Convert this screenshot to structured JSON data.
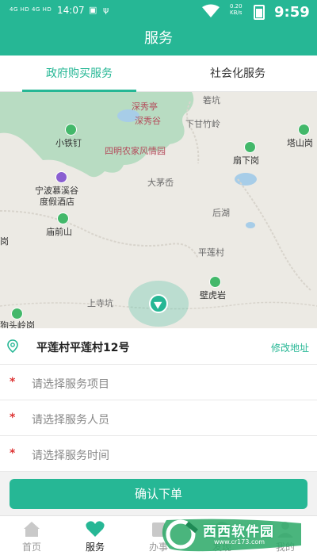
{
  "status_bar": {
    "signal": "4G HD 4G HD",
    "clock": "14:07",
    "speed": "0.20\nKB/s",
    "big_time": "9:59"
  },
  "header": {
    "title": "服务"
  },
  "tabs": [
    {
      "label": "政府购买服务",
      "active": true
    },
    {
      "label": "社会化服务",
      "active": false
    }
  ],
  "map": {
    "pois": [
      {
        "id": "shenxiuting",
        "label": "深秀亭",
        "style": "pink"
      },
      {
        "id": "shenxiugu",
        "label": "深秀谷",
        "style": "pink"
      },
      {
        "id": "ruokeng",
        "label": "箬坑",
        "style": "gray"
      },
      {
        "id": "xiaganzhuling",
        "label": "下甘竹岭",
        "style": "gray"
      },
      {
        "id": "tashanggang",
        "label": "塔山岗",
        "style": "normal"
      },
      {
        "id": "xiaotieding",
        "label": "小铁钉",
        "style": "normal"
      },
      {
        "id": "simingnongjia",
        "label": "四明农家风情园",
        "style": "pink"
      },
      {
        "id": "shanxiagang",
        "label": "扇下岗",
        "style": "normal"
      },
      {
        "id": "ningbo_hotel_1",
        "label": "宁波慕溪谷",
        "style": "normal"
      },
      {
        "id": "ningbo_hotel_2",
        "label": "度假酒店",
        "style": "normal"
      },
      {
        "id": "damaoan",
        "label": "大茅岙",
        "style": "gray"
      },
      {
        "id": "houhu",
        "label": "后湖",
        "style": "gray"
      },
      {
        "id": "miaoqianshan",
        "label": "庙前山",
        "style": "normal"
      },
      {
        "id": "gang_left",
        "label": "岗",
        "style": "normal"
      },
      {
        "id": "pinglian",
        "label": "平莲村",
        "style": "gray"
      },
      {
        "id": "bihuyan",
        "label": "壁虎岩",
        "style": "normal"
      },
      {
        "id": "shangsikeng",
        "label": "上寺坑",
        "style": "gray"
      },
      {
        "id": "goutouling",
        "label": "狗头岭岗",
        "style": "normal"
      }
    ]
  },
  "address": {
    "text": "平莲村平莲村12号",
    "edit_label": "修改地址"
  },
  "form": {
    "required_mark": "*",
    "fields": [
      {
        "placeholder": "请选择服务项目"
      },
      {
        "placeholder": "请选择服务人员"
      },
      {
        "placeholder": "请选择服务时间"
      }
    ]
  },
  "confirm_button": {
    "label": "确认下单"
  },
  "bottom_nav": [
    {
      "label": "首页",
      "icon": "home-icon",
      "active": false
    },
    {
      "label": "服务",
      "icon": "heart-icon",
      "active": true
    },
    {
      "label": "办事",
      "icon": "task-icon",
      "active": false
    },
    {
      "label": "发现",
      "icon": "discover-icon",
      "active": false
    },
    {
      "label": "我的",
      "icon": "profile-icon",
      "active": false
    }
  ],
  "watermark": {
    "text": "西西软件园",
    "url": "www.cr173.com"
  },
  "colors": {
    "brand": "#26b795",
    "required": "#dd3333"
  }
}
